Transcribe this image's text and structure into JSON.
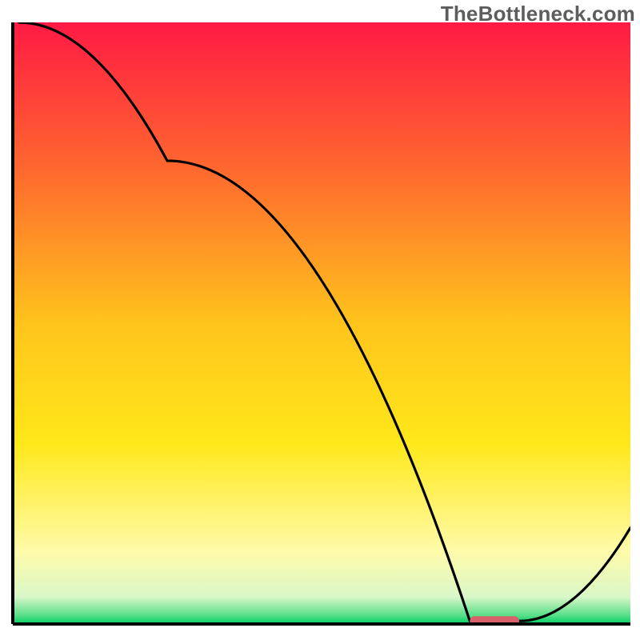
{
  "watermark": "TheBottleneck.com",
  "chart_data": {
    "type": "line",
    "title": "",
    "xlabel": "",
    "ylabel": "",
    "xlim": [
      0,
      100
    ],
    "ylim": [
      0,
      100
    ],
    "grid": false,
    "legend": false,
    "series": [
      {
        "name": "bottleneck-curve",
        "x": [
          1,
          25,
          74,
          82,
          100
        ],
        "y": [
          100,
          77,
          0.5,
          0.5,
          16
        ],
        "color": "#000000"
      }
    ],
    "marker": {
      "name": "optimal-range-marker",
      "x_start": 74,
      "x_end": 82,
      "y": 0.5,
      "color": "#d9626a"
    },
    "background_gradient": {
      "stops": [
        {
          "pos": 0.0,
          "color": "#ff1a44"
        },
        {
          "pos": 0.25,
          "color": "#ff6a2e"
        },
        {
          "pos": 0.5,
          "color": "#ffc41c"
        },
        {
          "pos": 0.7,
          "color": "#ffe81a"
        },
        {
          "pos": 0.88,
          "color": "#fffbaa"
        },
        {
          "pos": 0.955,
          "color": "#d9f7c8"
        },
        {
          "pos": 0.985,
          "color": "#5be089"
        },
        {
          "pos": 1.0,
          "color": "#00d063"
        }
      ]
    },
    "axes": {
      "left": {
        "visible": true,
        "color": "#000000",
        "width": 4
      },
      "bottom": {
        "visible": true,
        "color": "#000000",
        "width": 4
      },
      "ticks": "none"
    }
  }
}
